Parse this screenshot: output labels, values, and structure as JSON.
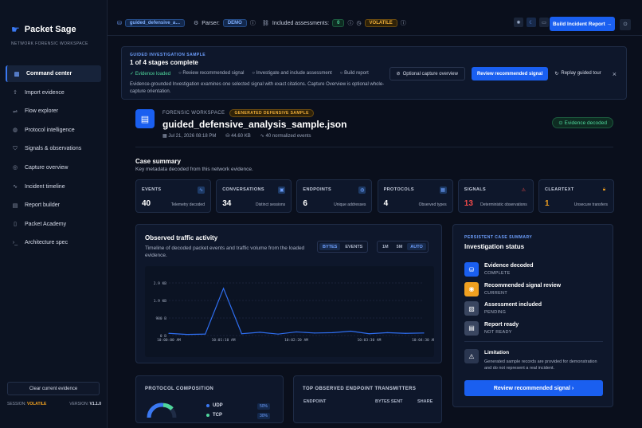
{
  "sidebar": {
    "brand": "Packet Sage",
    "subtitle": "NETWORK FORENSIC WORKSPACE",
    "items": [
      {
        "label": "Command center",
        "icon": "dashboard-icon",
        "active": true
      },
      {
        "label": "Import evidence",
        "icon": "upload-icon"
      },
      {
        "label": "Flow explorer",
        "icon": "flow-icon"
      },
      {
        "label": "Protocol intelligence",
        "icon": "globe-icon"
      },
      {
        "label": "Signals & observations",
        "icon": "shield-icon"
      },
      {
        "label": "Capture overview",
        "icon": "compass-icon"
      },
      {
        "label": "Incident timeline",
        "icon": "pulse-icon"
      },
      {
        "label": "Report builder",
        "icon": "document-icon"
      },
      {
        "label": "Packet Academy",
        "icon": "book-icon"
      },
      {
        "label": "Architecture spec",
        "icon": "terminal-icon"
      }
    ],
    "clear_button": "Clear current evidence",
    "session_label": "SESSION:",
    "session_value": "VOLATILE",
    "version_label": "VERSION:",
    "version_value": "V1.1.0"
  },
  "topbar": {
    "file_name": "guided_defensive_a…",
    "parser_label": "Parser:",
    "parser_value": "DEMO",
    "assessments_label": "Included assessments:",
    "assessments_value": "0",
    "status": "VOLATILE",
    "build_report": "Build Incident Report →"
  },
  "banner": {
    "kicker": "GUIDED INVESTIGATION SAMPLE",
    "title": "1 of 4 stages complete",
    "steps": [
      "Evidence loaded",
      "Review recommended signal",
      "Investigate and include assessment",
      "Build report"
    ],
    "description": "Evidence-grounded Investigation examines one selected signal with exact citations. Capture Overview is optional whole-capture orientation.",
    "optional_btn": "Optional capture overview",
    "review_btn": "Review recommended signal",
    "replay_btn": "Replay guided tour"
  },
  "file": {
    "kicker": "FORENSIC WORKSPACE",
    "badge": "GENERATED DEFENSIVE SAMPLE",
    "title": "guided_defensive_analysis_sample.json",
    "date": "Jul 21, 2026 08:18 PM",
    "size": "44.60 KB",
    "events": "40 normalized events",
    "decoded": "Evidence decoded"
  },
  "summary": {
    "title": "Case summary",
    "subtitle": "Key metadata decoded from this network evidence.",
    "cards": [
      {
        "label": "EVENTS",
        "value": "40",
        "note": "Telemetry decoded",
        "icon": "pulse-icon"
      },
      {
        "label": "CONVERSATIONS",
        "value": "34",
        "note": "Distinct sessions",
        "icon": "chat-icon"
      },
      {
        "label": "ENDPOINTS",
        "value": "6",
        "note": "Unique addresses",
        "icon": "globe-icon"
      },
      {
        "label": "PROTOCOLS",
        "value": "4",
        "note": "Observed types",
        "icon": "layers-icon"
      },
      {
        "label": "SIGNALS",
        "value": "13",
        "note": "Deterministic observations",
        "icon": "warning-icon",
        "color": "#ef4a4a"
      },
      {
        "label": "CLEARTEXT",
        "value": "1",
        "note": "Unsecure transfers",
        "icon": "lock-icon",
        "color": "#f0a020"
      }
    ]
  },
  "traffic": {
    "title": "Observed traffic activity",
    "description": "Timeline of decoded packet events and traffic volume from the loaded evidence.",
    "mode": [
      "BYTES",
      "EVENTS"
    ],
    "range": [
      "1M",
      "5M",
      "AUTO"
    ]
  },
  "chart_data": {
    "type": "line",
    "x": [
      "10:00:00 AM",
      "10:00:30 AM",
      "10:01:00 AM",
      "10:01:10 AM",
      "10:01:20 AM",
      "10:01:40 AM",
      "10:02:00 AM",
      "10:02:20 AM",
      "10:02:40 AM",
      "10:03:00 AM",
      "10:03:20 AM",
      "10:03:30 AM",
      "10:04:00 AM",
      "10:04:20 AM",
      "10:04:30 AM"
    ],
    "values": [
      120,
      60,
      80,
      2600,
      100,
      180,
      80,
      200,
      140,
      160,
      240,
      100,
      160,
      120,
      140
    ],
    "yticks": [
      "0 B",
      "980 B",
      "1.9 KB",
      "2.9 KB"
    ],
    "ymax": 2900,
    "xticks": [
      "10:00:00 AM",
      "10:01:10 AM",
      "10:02:20 AM",
      "10:03:30 AM",
      "10:04:30 AM"
    ]
  },
  "status_panel": {
    "kicker": "PERSISTENT CASE SUMMARY",
    "title": "Investigation status",
    "items": [
      {
        "label": "Evidence decoded",
        "state": "COMPLETE",
        "color": "#1a5ff0",
        "icon": "database-icon"
      },
      {
        "label": "Recommended signal review",
        "state": "CURRENT",
        "color": "#f0a020",
        "icon": "target-icon"
      },
      {
        "label": "Assessment included",
        "state": "PENDING",
        "color": "#3a4660",
        "icon": "clipboard-icon"
      },
      {
        "label": "Report ready",
        "state": "NOT READY",
        "color": "#3a4660",
        "icon": "document-icon"
      }
    ],
    "limit_title": "Limitation",
    "limit_text": "Generated sample records are provided for demonstration and do not represent a real incident.",
    "button": "Review recommended signal"
  },
  "protocol": {
    "title": "PROTOCOL COMPOSITION",
    "legend": [
      {
        "name": "UDP",
        "count": "50%",
        "color": "#3a78f2"
      },
      {
        "name": "TCP",
        "count": "30%",
        "color": "#4fd69c"
      }
    ]
  },
  "endpoints": {
    "title": "TOP OBSERVED ENDPOINT TRANSMITTERS",
    "headers": [
      "ENDPOINT",
      "BYTES SENT",
      "SHARE"
    ]
  }
}
